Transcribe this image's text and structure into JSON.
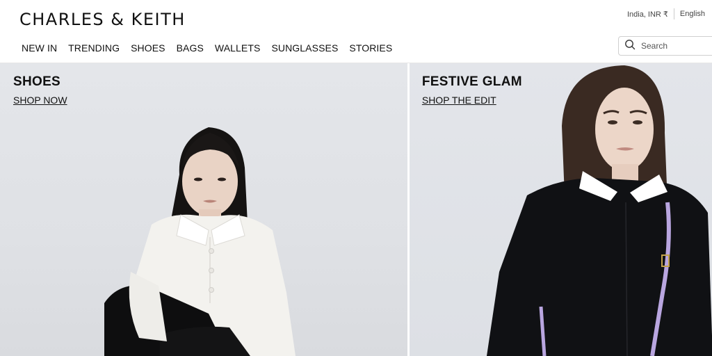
{
  "brand": {
    "logo": "CHARLES & KEITH"
  },
  "nav": {
    "items": [
      "NEW IN",
      "TRENDING",
      "SHOES",
      "BAGS",
      "WALLETS",
      "SUNGLASSES",
      "STORIES"
    ]
  },
  "utility": {
    "region": "India, INR ₹",
    "language": "English"
  },
  "search": {
    "placeholder": "Search",
    "icon": "search-icon"
  },
  "banners": [
    {
      "title": "SHOES",
      "cta": "SHOP NOW",
      "image": "model in white polo shirt sitting"
    },
    {
      "title": "FESTIVE GLAM",
      "cta": "SHOP THE EDIT",
      "image": "model in black jacket with lilac bag strap"
    }
  ],
  "colors": {
    "banner_bg": "#e2e4e8",
    "text": "#111111",
    "strap": "#b9a6e0"
  }
}
